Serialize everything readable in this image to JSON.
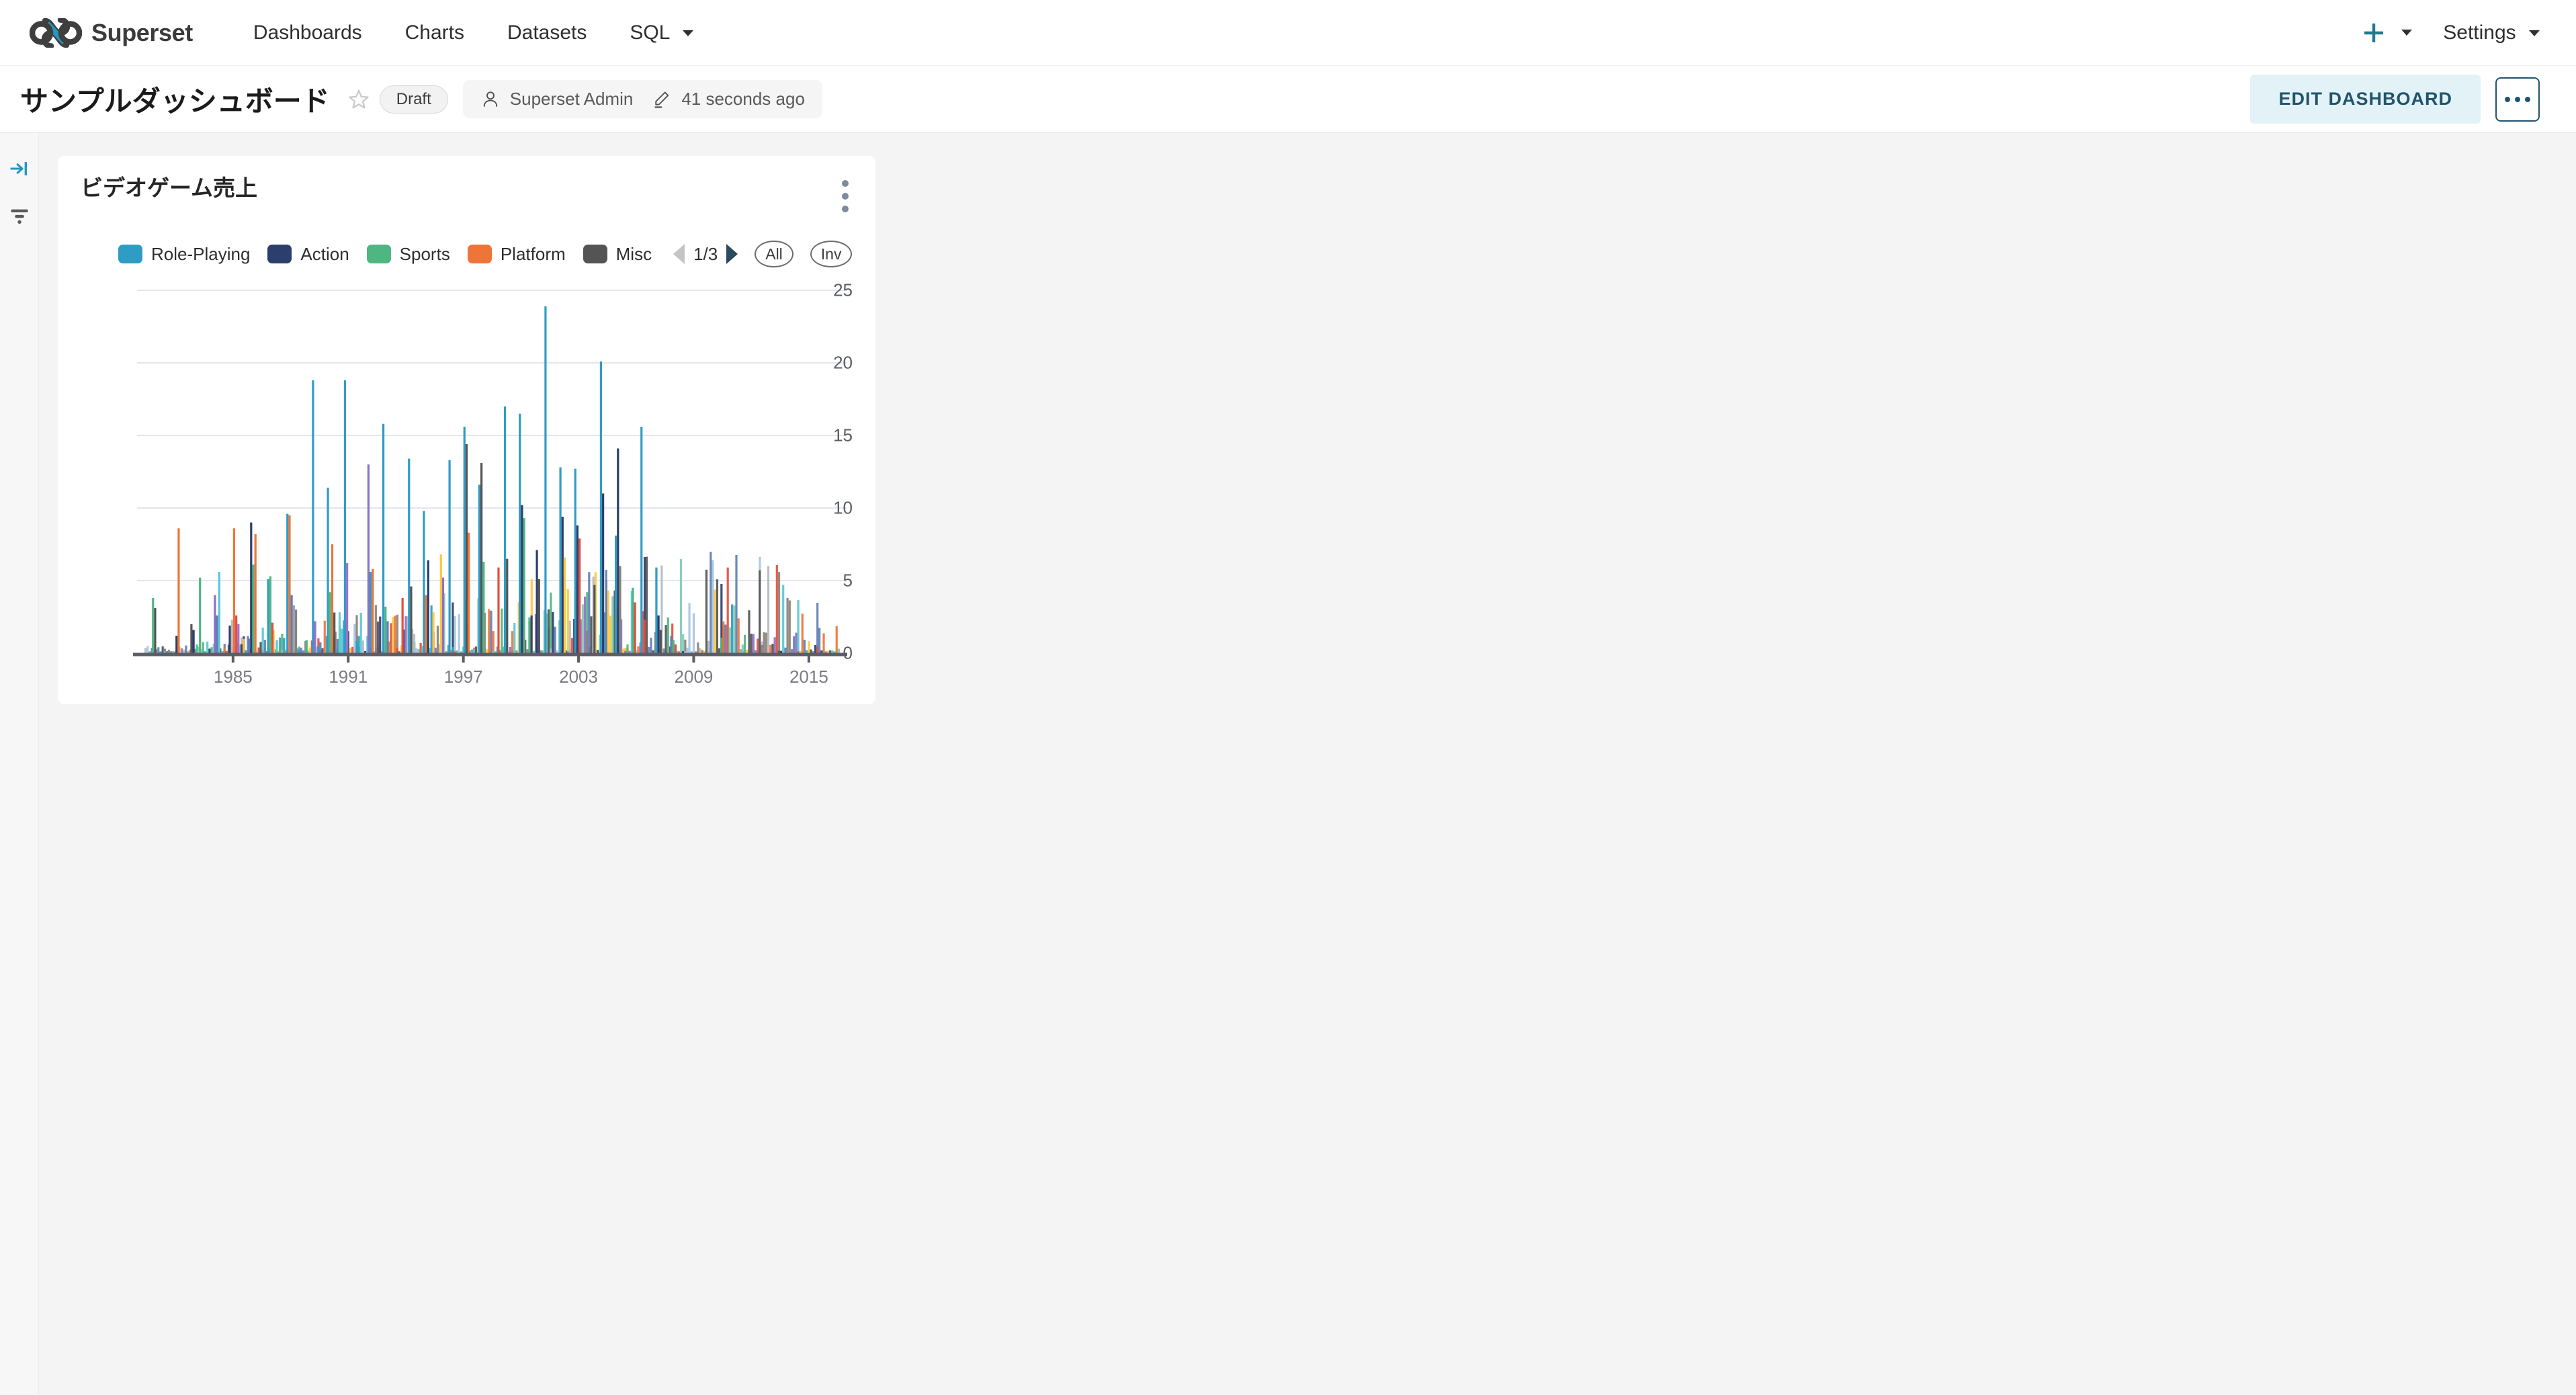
{
  "navbar": {
    "brand": "Superset",
    "brand_icon": "superset-infinity-logo",
    "links": [
      {
        "label": "Dashboards",
        "has_caret": false
      },
      {
        "label": "Charts",
        "has_caret": false
      },
      {
        "label": "Datasets",
        "has_caret": false
      },
      {
        "label": "SQL",
        "has_caret": true
      }
    ],
    "new_icon": "plus-icon",
    "settings_label": "Settings",
    "accent_color": "#20a7c9"
  },
  "dashboard_header": {
    "title": "サンプルダッシュボード",
    "star_icon": "star-outline-icon",
    "status_badge": "Draft",
    "owner_icon": "user-icon",
    "owner": "Superset Admin",
    "modified_icon": "pencil-icon",
    "modified": "41 seconds ago",
    "edit_button": "EDIT DASHBOARD",
    "more_button": "more-horizontal-icon",
    "edit_button_bg": "#e3f2f7",
    "edit_button_color": "#20546b"
  },
  "side_rail": {
    "items": [
      {
        "icon": "expand-panel-icon",
        "color": "#2596be"
      },
      {
        "icon": "filter-funnel-icon",
        "color": "#5a5a5a"
      }
    ]
  },
  "chart_card": {
    "title": "ビデオゲーム売上",
    "menu_icon": "vertical-dots-icon",
    "legend": {
      "items": [
        {
          "label": "Role-Playing",
          "color": "#2f9cc4"
        },
        {
          "label": "Action",
          "color": "#2c3e6b"
        },
        {
          "label": "Sports",
          "color": "#4fb681"
        },
        {
          "label": "Platform",
          "color": "#ef7437"
        },
        {
          "label": "Misc",
          "color": "#545454"
        }
      ],
      "prev_icon": "triangle-left-icon",
      "page": "1/3",
      "next_icon": "triangle-right-icon",
      "select_all": "All",
      "invert": "Inv"
    }
  },
  "chart_data": {
    "type": "bar",
    "title": "ビデオゲーム売上",
    "xlabel": "",
    "ylabel": "",
    "ylim": [
      0,
      25
    ],
    "yticks": [
      0,
      5,
      10,
      15,
      20,
      25
    ],
    "xticks": [
      "1985",
      "1991",
      "1997",
      "2003",
      "2009",
      "2015"
    ],
    "grid": true,
    "legend_position": "top",
    "x_range": [
      1980,
      2017
    ],
    "note": "Grouped thin bars per year per genre; many genres beyond the 5 shown on legend page 1/3.",
    "series": [
      {
        "name": "Role-Playing",
        "color": "#2f9cc4"
      },
      {
        "name": "Action",
        "color": "#2c3e6b"
      },
      {
        "name": "Sports",
        "color": "#4fb681"
      },
      {
        "name": "Platform",
        "color": "#ef7437"
      },
      {
        "name": "Misc",
        "color": "#545454"
      }
    ],
    "bars": [
      {
        "x": 1981,
        "v": 3.8,
        "c": "#4fb681"
      },
      {
        "x": 1981,
        "v": 3.1,
        "c": "#545454"
      },
      {
        "x": 1982,
        "v": 1.2,
        "c": "#2c3e6b"
      },
      {
        "x": 1982,
        "v": 8.6,
        "c": "#ef7437"
      },
      {
        "x": 1983,
        "v": 5.2,
        "c": "#4fb681"
      },
      {
        "x": 1983,
        "v": 2.0,
        "c": "#545454"
      },
      {
        "x": 1983,
        "v": 1.6,
        "c": "#2c3e6b"
      },
      {
        "x": 1984,
        "v": 4.0,
        "c": "#8e6fc9"
      },
      {
        "x": 1984,
        "v": 2.6,
        "c": "#5f7fb5"
      },
      {
        "x": 1984,
        "v": 5.6,
        "c": "#56c9d6"
      },
      {
        "x": 1985,
        "v": 1.9,
        "c": "#2c3e6b"
      },
      {
        "x": 1985,
        "v": 2.3,
        "c": "#b5bac4"
      },
      {
        "x": 1985,
        "v": 8.6,
        "c": "#ef7437"
      },
      {
        "x": 1985,
        "v": 2.6,
        "c": "#e0503f"
      },
      {
        "x": 1985,
        "v": 2.0,
        "c": "#a06fd0"
      },
      {
        "x": 1986,
        "v": 1.0,
        "c": "#5f7fb5"
      },
      {
        "x": 1986,
        "v": 9.0,
        "c": "#2c3e6b"
      },
      {
        "x": 1986,
        "v": 6.1,
        "c": "#4fb681"
      },
      {
        "x": 1986,
        "v": 8.2,
        "c": "#ef7437"
      },
      {
        "x": 1987,
        "v": 0.9,
        "c": "#56c9d6"
      },
      {
        "x": 1987,
        "v": 5.1,
        "c": "#2f9cc4"
      },
      {
        "x": 1987,
        "v": 5.3,
        "c": "#4fb681"
      },
      {
        "x": 1987,
        "v": 2.1,
        "c": "#e0503f"
      },
      {
        "x": 1988,
        "v": 3.3,
        "c": "#9aa2b1"
      },
      {
        "x": 1988,
        "v": 3.0,
        "c": "#8b8176"
      },
      {
        "x": 1988,
        "v": 9.6,
        "c": "#2f9cc4"
      },
      {
        "x": 1988,
        "v": 9.5,
        "c": "#ef7437"
      },
      {
        "x": 1988,
        "v": 4.0,
        "c": "#5f7fb5"
      },
      {
        "x": 1989,
        "v": 18.8,
        "c": "#2f9cc4"
      },
      {
        "x": 1989,
        "v": 2.2,
        "c": "#a06fd0"
      },
      {
        "x": 1989,
        "v": 0.9,
        "c": "#4fb681"
      },
      {
        "x": 1990,
        "v": 11.4,
        "c": "#2f9cc4"
      },
      {
        "x": 1990,
        "v": 4.2,
        "c": "#4fb681"
      },
      {
        "x": 1990,
        "v": 7.5,
        "c": "#ef7437"
      },
      {
        "x": 1990,
        "v": 2.8,
        "c": "#545454"
      },
      {
        "x": 1991,
        "v": 18.8,
        "c": "#2f9cc4"
      },
      {
        "x": 1991,
        "v": 6.2,
        "c": "#a06fd0"
      },
      {
        "x": 1992,
        "v": 13.0,
        "c": "#8e6fc9"
      },
      {
        "x": 1992,
        "v": 5.6,
        "c": "#2f9cc4"
      },
      {
        "x": 1992,
        "v": 5.8,
        "c": "#ef7437"
      },
      {
        "x": 1993,
        "v": 15.8,
        "c": "#2f9cc4"
      },
      {
        "x": 1993,
        "v": 3.2,
        "c": "#4fb681"
      },
      {
        "x": 1993,
        "v": 2.2,
        "c": "#5f7fb5"
      },
      {
        "x": 1994,
        "v": 13.4,
        "c": "#2f9cc4"
      },
      {
        "x": 1994,
        "v": 4.6,
        "c": "#545454"
      },
      {
        "x": 1994,
        "v": 3.8,
        "c": "#e0503f"
      },
      {
        "x": 1995,
        "v": 9.8,
        "c": "#2f9cc4"
      },
      {
        "x": 1995,
        "v": 4.0,
        "c": "#ef7437"
      },
      {
        "x": 1995,
        "v": 6.4,
        "c": "#2c3e6b"
      },
      {
        "x": 1996,
        "v": 13.3,
        "c": "#2f9cc4"
      },
      {
        "x": 1996,
        "v": 6.8,
        "c": "#ffc83d"
      },
      {
        "x": 1996,
        "v": 5.2,
        "c": "#8e6fc9"
      },
      {
        "x": 1997,
        "v": 15.6,
        "c": "#2f9cc4"
      },
      {
        "x": 1997,
        "v": 14.4,
        "c": "#545454"
      },
      {
        "x": 1997,
        "v": 8.3,
        "c": "#ef7437"
      },
      {
        "x": 1998,
        "v": 11.6,
        "c": "#2f9cc4"
      },
      {
        "x": 1998,
        "v": 13.1,
        "c": "#545454"
      },
      {
        "x": 1998,
        "v": 6.3,
        "c": "#4fb681"
      },
      {
        "x": 1999,
        "v": 17.0,
        "c": "#2f9cc4"
      },
      {
        "x": 1999,
        "v": 6.5,
        "c": "#545454"
      },
      {
        "x": 1999,
        "v": 5.9,
        "c": "#e0503f"
      },
      {
        "x": 2000,
        "v": 16.5,
        "c": "#2f9cc4"
      },
      {
        "x": 2000,
        "v": 10.2,
        "c": "#2c3e6b"
      },
      {
        "x": 2000,
        "v": 9.3,
        "c": "#4fb681"
      },
      {
        "x": 2001,
        "v": 23.9,
        "c": "#2f9cc4"
      },
      {
        "x": 2001,
        "v": 7.1,
        "c": "#2c3e6b"
      },
      {
        "x": 2001,
        "v": 5.1,
        "c": "#545454"
      },
      {
        "x": 2002,
        "v": 12.8,
        "c": "#2f9cc4"
      },
      {
        "x": 2002,
        "v": 9.4,
        "c": "#2c3e6b"
      },
      {
        "x": 2002,
        "v": 6.6,
        "c": "#ffc83d"
      },
      {
        "x": 2003,
        "v": 12.7,
        "c": "#2f9cc4"
      },
      {
        "x": 2003,
        "v": 8.8,
        "c": "#2c3e6b"
      },
      {
        "x": 2003,
        "v": 7.9,
        "c": "#e0503f"
      },
      {
        "x": 2004,
        "v": 20.1,
        "c": "#2f9cc4"
      },
      {
        "x": 2004,
        "v": 11.0,
        "c": "#2c3e6b"
      },
      {
        "x": 2004,
        "v": 4.7,
        "c": "#545454"
      },
      {
        "x": 2005,
        "v": 8.1,
        "c": "#2f9cc4"
      },
      {
        "x": 2005,
        "v": 14.1,
        "c": "#2c3e6b"
      },
      {
        "x": 2005,
        "v": 6.0,
        "c": "#8b8176"
      },
      {
        "x": 2006,
        "v": 15.6,
        "c": "#2f9cc4"
      },
      {
        "x": 2006,
        "v": 4.5,
        "c": "#4fb681"
      },
      {
        "x": 2006,
        "v": 3.5,
        "c": "#e0503f"
      },
      {
        "x": 2007,
        "v": 5.9,
        "c": "#2f9cc4"
      },
      {
        "x": 2007,
        "v": 2.6,
        "c": "#2c3e6b"
      },
      {
        "x": 2007,
        "v": 1.6,
        "c": "#545454"
      },
      {
        "x": 2008,
        "v": 1.2,
        "c": "#5f7fb5"
      },
      {
        "x": 2008,
        "v": 0.9,
        "c": "#4fb681"
      },
      {
        "x": 2008,
        "v": 0.6,
        "c": "#e0503f"
      }
    ]
  }
}
